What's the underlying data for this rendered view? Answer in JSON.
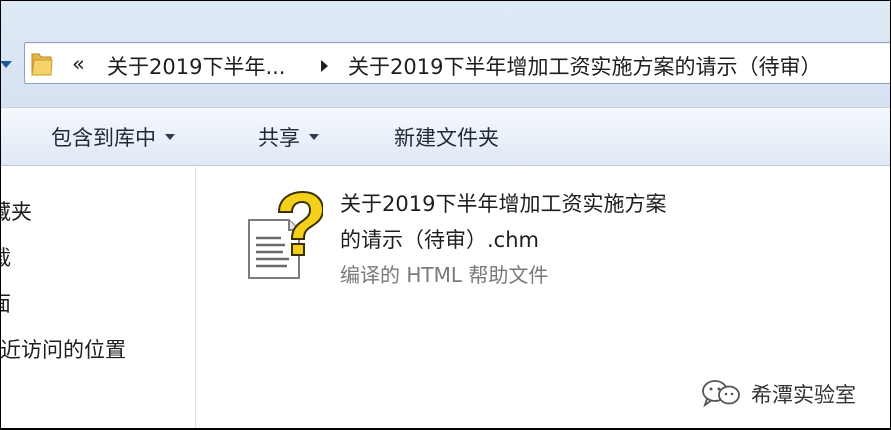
{
  "address_bar": {
    "overflow_chevrons": "«",
    "crumbs": [
      "关于2019下半年...",
      "关于2019下半年增加工资实施方案的请示（待审）"
    ]
  },
  "command_bar": {
    "include_in_library": "包含到库中",
    "share": "共享",
    "new_folder": "新建文件夹"
  },
  "nav_pane": {
    "items": [
      "藏夹",
      "载",
      "面",
      "近访问的位置"
    ]
  },
  "file": {
    "name_line1": "关于2019下半年增加工资实施方案",
    "name_line2": "的请示（待审）.chm",
    "type": "编译的 HTML 帮助文件",
    "icon": "chm-help-file-icon"
  },
  "watermark": {
    "text": "希潭实验室",
    "icon": "wechat-icon"
  },
  "colors": {
    "accent": "#1c5a9a",
    "strip": "#dbe6f4",
    "help_yellow": "#f4d01a"
  }
}
